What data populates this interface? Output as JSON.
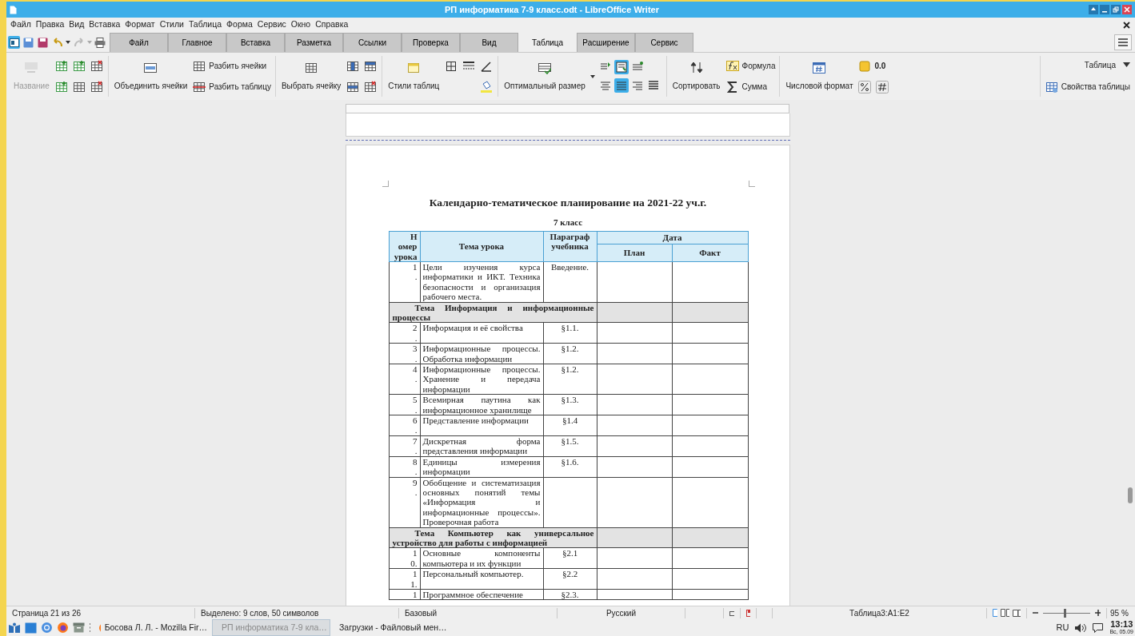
{
  "window": {
    "title": "РП информатика 7-9 класс.odt - LibreOffice Writer"
  },
  "menu": [
    "Файл",
    "Правка",
    "Вид",
    "Вставка",
    "Формат",
    "Стили",
    "Таблица",
    "Форма",
    "Сервис",
    "Окно",
    "Справка"
  ],
  "tabs": [
    {
      "label": "Файл",
      "selected": false
    },
    {
      "label": "Главное",
      "selected": false
    },
    {
      "label": "Вставка",
      "selected": false
    },
    {
      "label": "Разметка",
      "selected": false
    },
    {
      "label": "Ссылки",
      "selected": false
    },
    {
      "label": "Проверка",
      "selected": false
    },
    {
      "label": "Вид",
      "selected": false
    },
    {
      "label": "Таблица",
      "selected": true
    },
    {
      "label": "Расширение",
      "selected": false
    },
    {
      "label": "Сервис",
      "selected": false
    }
  ],
  "ribbon": {
    "name_button": {
      "label": "Название",
      "disabled": true
    },
    "merge_cells": "Объединить ячейки",
    "split_cells": "Разбить ячейки",
    "split_table": "Разбить таблицу",
    "select_cell": "Выбрать ячейку",
    "table_styles": "Стили таблиц",
    "optimal_size": "Оптимальный размер",
    "alignment_buttons": [
      {
        "selected": false
      },
      {
        "selected": true
      },
      {
        "selected": false
      },
      {
        "selected": false
      },
      {
        "selected": true
      },
      {
        "selected": false
      },
      {
        "selected": false
      }
    ],
    "sort": "Сортировать",
    "formula": "Формула",
    "sum": "Сумма",
    "number_format": "Числовой формат",
    "number_format_value": "0.0",
    "context_menu": "Таблица",
    "table_properties": "Свойства таблицы"
  },
  "document": {
    "heading": "Календарно-тематическое планирование на 2021-22 уч.г.",
    "subheading": "7 класс",
    "table": {
      "header": {
        "number": "Номер урока",
        "topic": "Тема урока",
        "paragraph": "Параграф учебника",
        "date": "Дата",
        "plan": "План",
        "fact": "Факт"
      },
      "rows": [
        {
          "kind": "lesson",
          "number": "1.",
          "topic": "Цели изучения курса информатики и ИКТ. Техника безопасности и организация рабочего места.",
          "paragraph": "Введение."
        },
        {
          "kind": "section",
          "title": "Тема Информация и информационные процессы"
        },
        {
          "kind": "lesson",
          "number": "2.",
          "topic": "Информация и её свойства",
          "paragraph": "§1.1."
        },
        {
          "kind": "lesson",
          "number": "3.",
          "topic": "Информационные процессы. Обработка информации",
          "paragraph": "§1.2."
        },
        {
          "kind": "lesson",
          "number": "4.",
          "topic": "Информационные процессы. Хранение и передача информации",
          "paragraph": "§1.2."
        },
        {
          "kind": "lesson",
          "number": "5.",
          "topic": "Всемирная паутина как информационное хранилище",
          "paragraph": "§1.3."
        },
        {
          "kind": "lesson",
          "number": "6.",
          "topic": "Представление информации",
          "paragraph": "§1.4"
        },
        {
          "kind": "lesson",
          "number": "7.",
          "topic": "Дискретная форма представления информации",
          "paragraph": "§1.5."
        },
        {
          "kind": "lesson",
          "number": "8.",
          "topic": "Единицы измерения информации",
          "paragraph": "§1.6."
        },
        {
          "kind": "lesson",
          "number": "9.",
          "topic": "Обобщение и систематизация основных понятий темы «Информация и информационные процессы». Проверочная работа"
        },
        {
          "kind": "section",
          "title": "Тема Компьютер как универсальное устройство для работы с информацией"
        },
        {
          "kind": "lesson",
          "number": "10.",
          "topic": "Основные компоненты компьютера и их функции",
          "paragraph": "§2.1"
        },
        {
          "kind": "lesson",
          "number": "11.",
          "topic": "Персональный компьютер.",
          "paragraph": "§2.2"
        },
        {
          "kind": "lesson",
          "number": "1",
          "topic": "Программное обеспечение",
          "paragraph": "§2.3."
        }
      ]
    }
  },
  "status_bar": {
    "page": "Страница 21 из 26",
    "selection": "Выделено: 9 слов, 50 символов",
    "style": "Базовый",
    "language": "Русский",
    "cell": "Таблица3:A1:E2",
    "zoom": {
      "level": 0.47,
      "reading": "95 %"
    }
  },
  "taskbar": {
    "windows": [
      {
        "label": "Босова Л. Л. - Mozilla Fir…",
        "selected": false
      },
      {
        "label": "РП информатика 7-9 кла…",
        "selected": true
      },
      {
        "label": "Загрузки - Файловый мен…",
        "selected": false
      }
    ],
    "keyboard_layout": "RU",
    "time": "13:13",
    "date": "Вс, 05.09"
  }
}
